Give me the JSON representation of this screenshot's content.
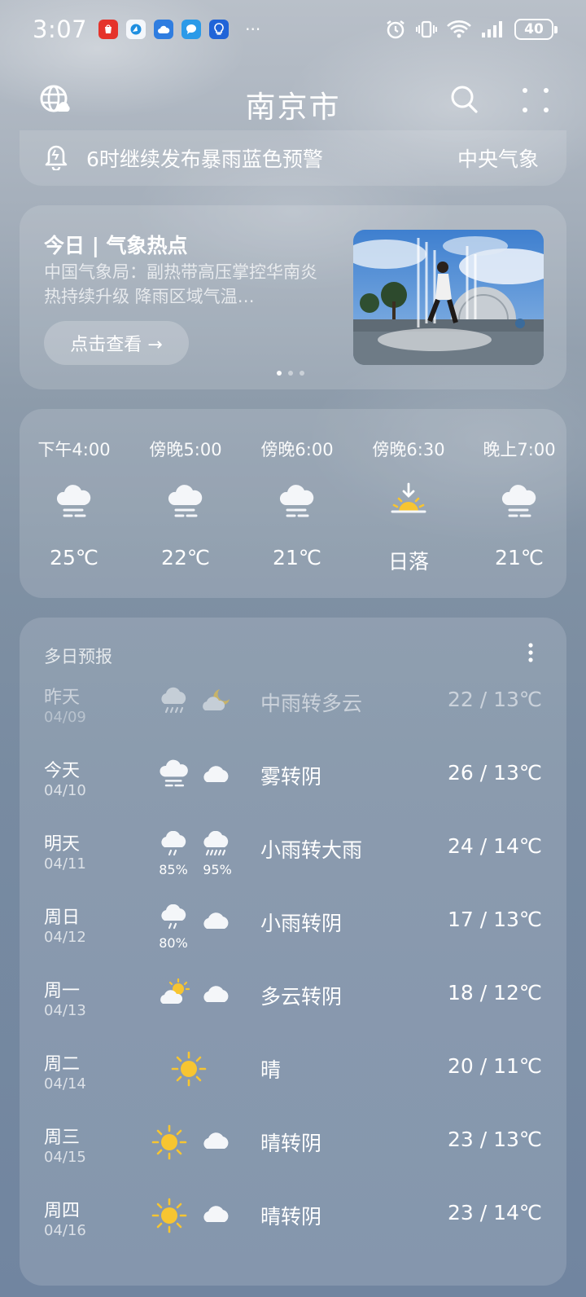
{
  "status_bar": {
    "time": "3:07",
    "more": "···",
    "battery": "40"
  },
  "header": {
    "city": "南京市"
  },
  "alert": {
    "text": "6时继续发布暴雨蓝色预警",
    "source": "中央气象"
  },
  "hot_card": {
    "title": "今日 | 气象热点",
    "description": "中国气象局：副热带高压掌控华南炎热持续升级 降雨区域气温…",
    "button_label": "点击查看 →"
  },
  "hourly": [
    {
      "time": "下午4:00",
      "icon": "fog-cloud-icon",
      "value": "25℃"
    },
    {
      "time": "傍晚5:00",
      "icon": "fog-cloud-icon",
      "value": "22℃"
    },
    {
      "time": "傍晚6:00",
      "icon": "fog-cloud-icon",
      "value": "21℃"
    },
    {
      "time": "傍晚6:30",
      "icon": "sunset-icon",
      "value": "日落"
    },
    {
      "time": "晚上7:00",
      "icon": "fog-cloud-icon",
      "value": "21℃"
    }
  ],
  "daily": {
    "title": "多日预报",
    "rows": [
      {
        "day": "昨天",
        "date": "04/09",
        "icons": [
          "rain-cloud-icon",
          "cloudy-moon-icon"
        ],
        "precip": [
          "",
          ""
        ],
        "desc": "中雨转多云",
        "temp": "22 / 13℃",
        "past": true
      },
      {
        "day": "今天",
        "date": "04/10",
        "icons": [
          "fog-cloud-icon",
          "cloud-icon"
        ],
        "precip": [
          "",
          ""
        ],
        "desc": "雾转阴",
        "temp": "26 / 13℃"
      },
      {
        "day": "明天",
        "date": "04/11",
        "icons": [
          "light-rain-icon",
          "heavy-rain-icon"
        ],
        "precip": [
          "85%",
          "95%"
        ],
        "desc": "小雨转大雨",
        "temp": "24 / 14℃"
      },
      {
        "day": "周日",
        "date": "04/12",
        "icons": [
          "light-rain-icon",
          "cloud-icon"
        ],
        "precip": [
          "80%",
          ""
        ],
        "desc": "小雨转阴",
        "temp": "17 / 13℃"
      },
      {
        "day": "周一",
        "date": "04/13",
        "icons": [
          "partly-cloudy-icon",
          "cloud-icon"
        ],
        "precip": [
          "",
          ""
        ],
        "desc": "多云转阴",
        "temp": "18 / 12℃"
      },
      {
        "day": "周二",
        "date": "04/14",
        "icons": [
          "sun-icon"
        ],
        "precip": [
          ""
        ],
        "desc": "晴",
        "temp": "20 / 11℃"
      },
      {
        "day": "周三",
        "date": "04/15",
        "icons": [
          "sun-icon",
          "cloud-icon"
        ],
        "precip": [
          "",
          ""
        ],
        "desc": "晴转阴",
        "temp": "23 / 13℃"
      },
      {
        "day": "周四",
        "date": "04/16",
        "icons": [
          "sun-icon",
          "cloud-icon"
        ],
        "precip": [
          "",
          ""
        ],
        "desc": "晴转阴",
        "temp": "23 / 14℃"
      }
    ]
  },
  "colors": {
    "sun": "#f7c531",
    "cloud": "#f4f6f9"
  }
}
